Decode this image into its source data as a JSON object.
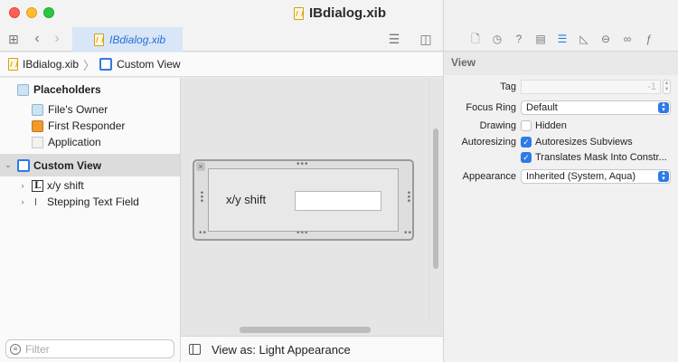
{
  "window": {
    "title": "IBdialog.xib"
  },
  "tabbar": {
    "tab_label": "IBdialog.xib"
  },
  "breadcrumb": {
    "file": "IBdialog.xib",
    "item": "Custom View"
  },
  "outline": {
    "placeholders_label": "Placeholders",
    "files_owner": "File's Owner",
    "first_responder": "First Responder",
    "application": "Application",
    "custom_view": "Custom View",
    "children": [
      "x/y shift",
      "Stepping Text Field"
    ],
    "filter_placeholder": "Filter"
  },
  "canvas": {
    "label_text": "x/y shift",
    "field_value": "",
    "view_as": "View as: Light Appearance"
  },
  "inspector": {
    "section": "View",
    "tag_label": "Tag",
    "tag_value": "-1",
    "focus_ring_label": "Focus Ring",
    "focus_ring_value": "Default",
    "drawing_label": "Drawing",
    "hidden_label": "Hidden",
    "autoresizing_label": "Autoresizing",
    "autoresizes_label": "Autoresizes Subviews",
    "translates_label": "Translates Mask Into Constr...",
    "appearance_label": "Appearance",
    "appearance_value": "Inherited (System, Aqua)",
    "hidden_checked": false,
    "autoresizes_checked": true,
    "translates_checked": true
  },
  "colors": {
    "accent": "#2d7be5",
    "selection": "#dcdcdc",
    "tab_bg": "#d8e6f8"
  }
}
